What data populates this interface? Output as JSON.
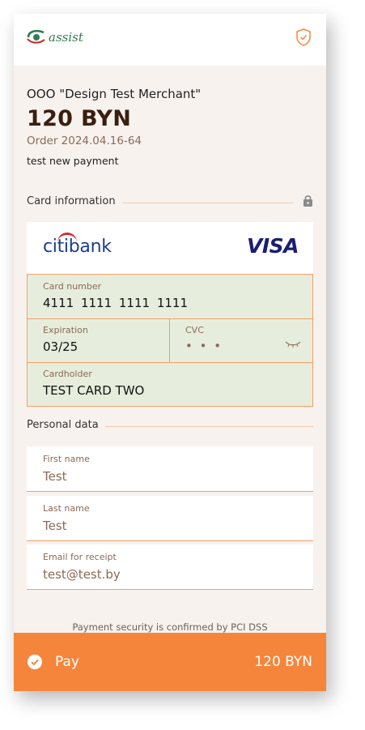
{
  "header": {
    "logo_text": "assist",
    "shield_icon": "shield-check-icon"
  },
  "payment": {
    "merchant": "OOO \"Design Test Merchant\"",
    "amount": "120 BYN",
    "order": "Order 2024.04.16-64",
    "description": "test new payment"
  },
  "card_section": {
    "title": "Card information",
    "lock_icon": "lock-icon"
  },
  "bank": {
    "name_citi": "citi",
    "name_bank": "bank",
    "network": "VISA"
  },
  "card_form": {
    "number_label": "Card number",
    "number_value": "4111 1111 1111 1111",
    "expiration_label": "Expiration",
    "expiration_value": "03/25",
    "cvc_label": "CVC",
    "cvc_value": "• • •",
    "cardholder_label": "Cardholder",
    "cardholder_value": "TEST CARD TWO"
  },
  "personal_section": {
    "title": "Personal data"
  },
  "personal_fields": {
    "first_name_label": "First name",
    "first_name_value": "Test",
    "last_name_label": "Last name",
    "last_name_value": "Test",
    "email_label": "Email for receipt",
    "email_value": "test@test.by"
  },
  "security_note": "Payment security is confirmed by PCI DSS",
  "pay_bar": {
    "label": "Pay",
    "amount": "120 BYN"
  },
  "colors": {
    "accent": "#f5853b",
    "background": "#f8f2ee",
    "card_fill": "#e6eddd",
    "brand_green": "#2e7d4f"
  }
}
